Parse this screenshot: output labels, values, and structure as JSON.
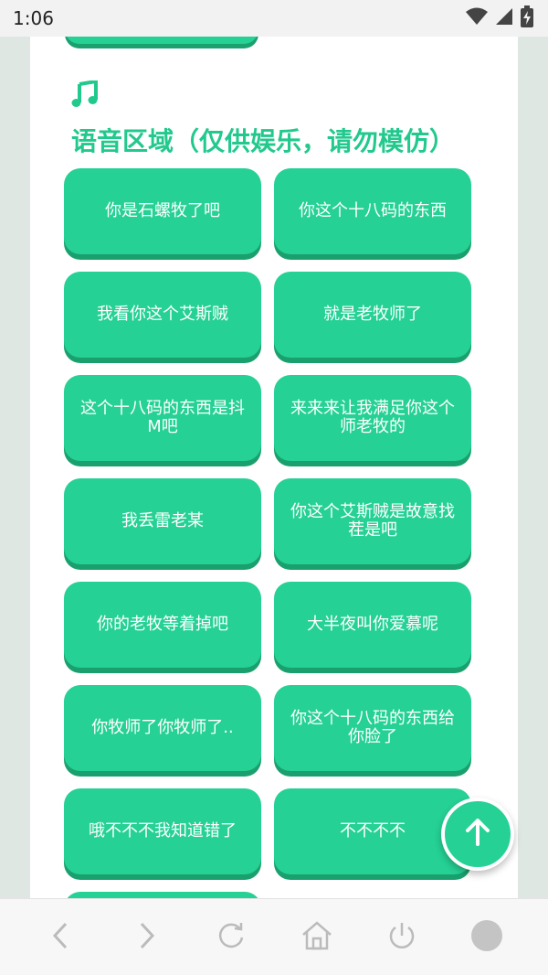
{
  "status_bar": {
    "time": "1:06",
    "icons": [
      "wifi-icon",
      "cellular-signal-icon",
      "battery-charging-icon"
    ]
  },
  "section": {
    "icon": "music-note-icon",
    "title": "语音区域（仅供娱乐，请勿模仿）",
    "accent_color": "#22c98d"
  },
  "voice_buttons": [
    {
      "label": "你是石螺牧了吧"
    },
    {
      "label": "你这个十八码的东西"
    },
    {
      "label": "我看你这个艾斯贼"
    },
    {
      "label": "就是老牧师了"
    },
    {
      "label": "这个十八码的东西是抖M吧"
    },
    {
      "label": "来来来让我满足你这个师老牧的"
    },
    {
      "label": "我丢雷老某"
    },
    {
      "label": "你这个艾斯贼是故意找茬是吧"
    },
    {
      "label": "你的老牧等着掉吧"
    },
    {
      "label": "大半夜叫你爱慕呢"
    },
    {
      "label": "你牧师了你牧师了.."
    },
    {
      "label": "你这个十八码的东西给你脸了"
    },
    {
      "label": "哦不不不我知道错了"
    },
    {
      "label": "不不不不"
    }
  ],
  "button_color": "#25d195",
  "scroll_top_button": {
    "icon": "arrow-up-icon"
  },
  "nav_bar": {
    "items": [
      "back-icon",
      "forward-icon",
      "refresh-icon",
      "home-icon",
      "power-icon",
      "circle-icon"
    ]
  }
}
